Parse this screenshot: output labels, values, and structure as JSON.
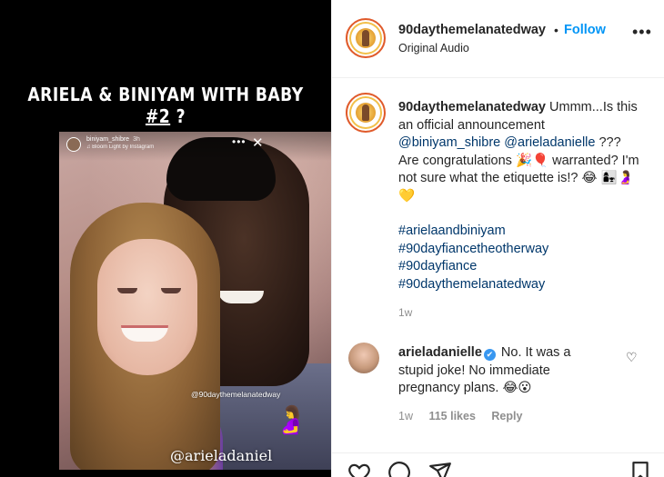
{
  "media": {
    "headline_part1": "ARIELA & BINIYAM WITH BABY ",
    "headline_underlined": "#2",
    "headline_part2": " ?",
    "story_user": "biniyam_shibre",
    "story_time": "3h",
    "story_sub": "♫ Bloom Light by Instagram",
    "story_mention": "@90daythemelanatedway",
    "story_emoji": "🤰",
    "story_tag": "@arieladaniel"
  },
  "header": {
    "username": "90daythemelanatedway",
    "dot": "•",
    "follow_label": "Follow",
    "audio": "Original Audio",
    "more": "•••"
  },
  "caption": {
    "username": "90daythemelanatedway",
    "text_1": " Ummm...Is this an official announcement ",
    "mention_1": "@biniyam_shibre",
    "mention_2": "@arieladanielle",
    "text_2": " ??? Are congratulations 🎉🎈 warranted? I'm not sure what the etiquette is!? 😂 👩‍👧🤰💛",
    "hashtags": [
      "#arielaandbiniyam",
      "#90dayfiancetheotherway",
      "#90dayfiance",
      "#90daythemelanatedway"
    ],
    "time": "1w"
  },
  "comment": {
    "username": "arieladanielle",
    "verified": "✔",
    "text": " No. It was a stupid joke! No immediate pregnancy plans. 😂😮",
    "time": "1w",
    "likes": "115 likes",
    "reply_label": "Reply",
    "heart": "♡"
  },
  "icons": {
    "like": "heart-icon",
    "comment": "comment-icon",
    "share": "share-icon",
    "save": "bookmark-icon"
  },
  "colors": {
    "accent": "#0095f6",
    "link": "#00376b",
    "muted": "#8e8e8e",
    "verified": "#3897f0"
  }
}
